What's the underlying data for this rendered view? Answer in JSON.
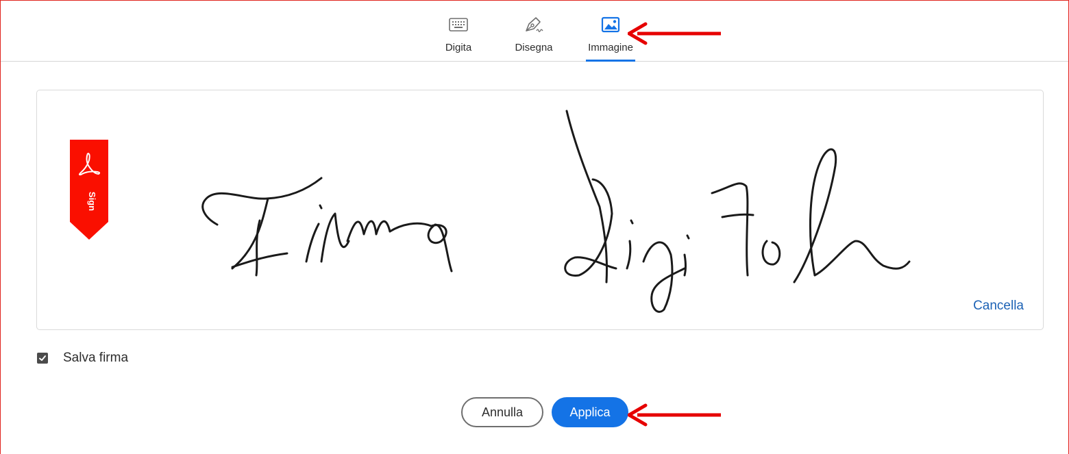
{
  "tabs": [
    {
      "label": "Digita",
      "icon": "keyboard-icon",
      "active": false
    },
    {
      "label": "Disegna",
      "icon": "pen-draw-icon",
      "active": false
    },
    {
      "label": "Immagine",
      "icon": "image-icon",
      "active": true
    }
  ],
  "signature_area": {
    "sign_tag_text": "Sign",
    "signature_text": "Firma Digitale",
    "clear_label": "Cancella"
  },
  "save_signature": {
    "label": "Salva firma",
    "checked": true
  },
  "buttons": {
    "cancel_label": "Annulla",
    "apply_label": "Applica"
  },
  "colors": {
    "accent_blue": "#1473e6",
    "link_blue": "#1c62b5",
    "annotation_red": "#e60000",
    "adobe_red": "#fa0f00"
  }
}
